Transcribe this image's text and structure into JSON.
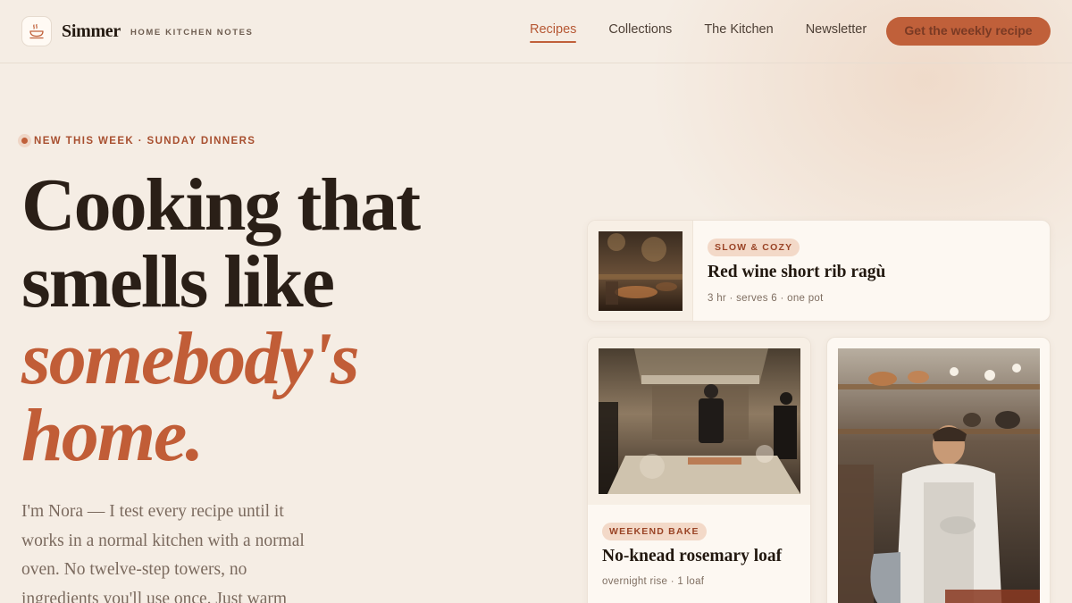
{
  "header": {
    "brand": "Simmer",
    "tagline": "HOME KITCHEN NOTES",
    "logo_icon": "steaming-pot-icon",
    "nav": [
      {
        "label": "Recipes",
        "active": true
      },
      {
        "label": "Collections",
        "active": false
      },
      {
        "label": "The Kitchen",
        "active": false
      },
      {
        "label": "Newsletter",
        "active": false
      }
    ],
    "cta_label": "Get the weekly recipe"
  },
  "hero": {
    "kicker": "NEW THIS WEEK · SUNDAY DINNERS",
    "headline_line1": "Cooking that",
    "headline_line2": "smells like",
    "headline_accent1": "somebody's",
    "headline_accent2": "home.",
    "lede": "I'm Nora — I test every recipe until it works in a normal kitchen with a normal oven. No twelve-step towers, no ingredients you'll use once. Just warm"
  },
  "cards": {
    "featured": {
      "tag": "SLOW & COZY",
      "title": "Red wine short rib ragù",
      "meta": "3 hr · serves 6 · one pot"
    },
    "loaf": {
      "tag": "WEEKEND BAKE",
      "title": "No-knead rosemary loaf",
      "meta": "overnight rise · 1 loaf"
    }
  },
  "colors": {
    "accent": "#c0603a",
    "background": "#f5ede4",
    "ink": "#2a201a"
  }
}
